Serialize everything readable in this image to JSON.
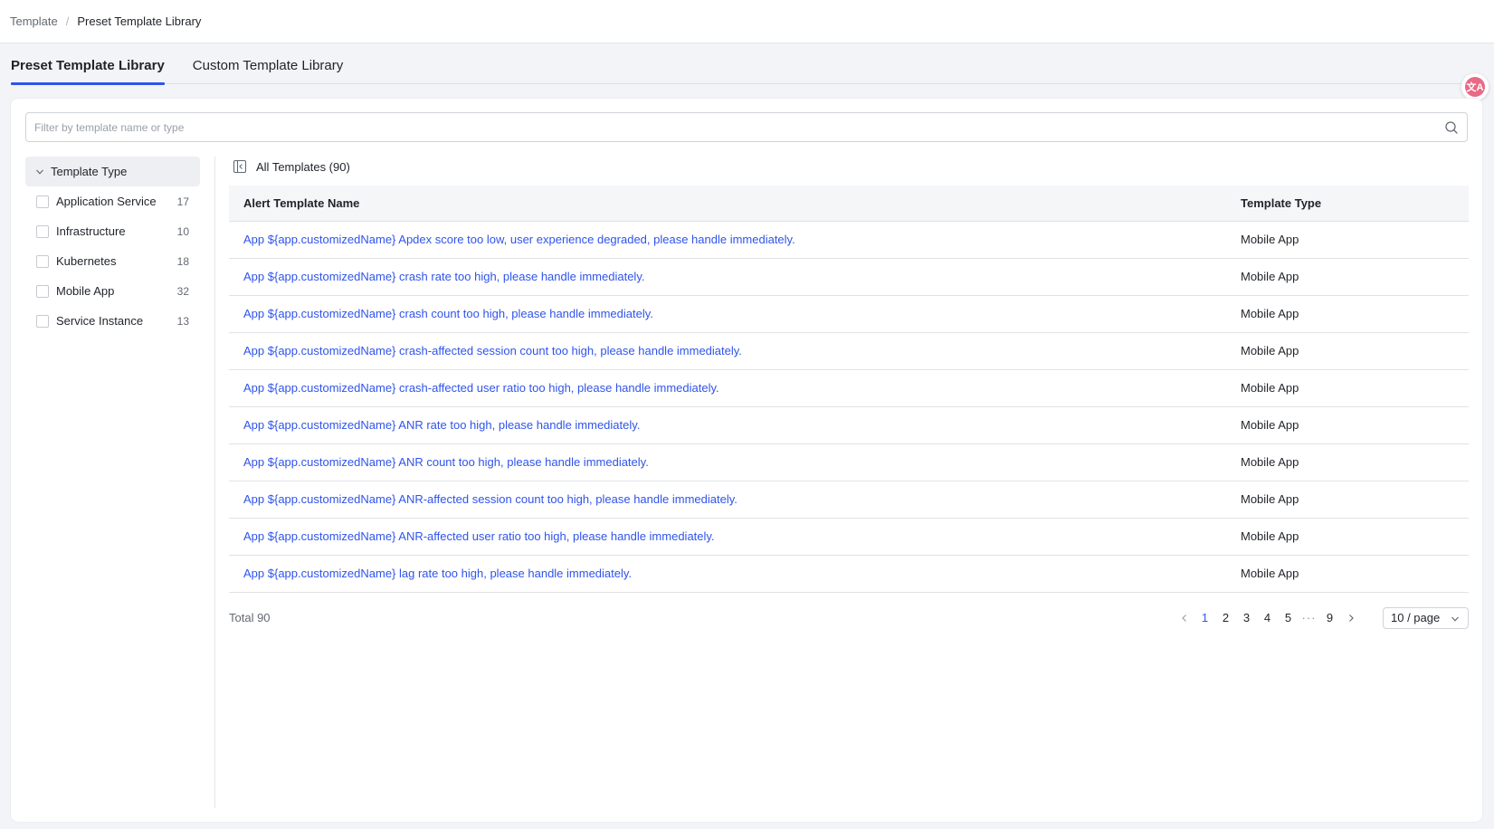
{
  "breadcrumb": {
    "root": "Template",
    "separator": "/",
    "current": "Preset Template Library"
  },
  "tabs": [
    {
      "label": "Preset Template Library",
      "active": true
    },
    {
      "label": "Custom Template Library",
      "active": false
    }
  ],
  "search": {
    "placeholder": "Filter by template name or type",
    "value": ""
  },
  "sidebar": {
    "header": "Template Type",
    "items": [
      {
        "label": "Application Service",
        "count": "17"
      },
      {
        "label": "Infrastructure",
        "count": "10"
      },
      {
        "label": "Kubernetes",
        "count": "18"
      },
      {
        "label": "Mobile App",
        "count": "32"
      },
      {
        "label": "Service Instance",
        "count": "13"
      }
    ]
  },
  "main": {
    "title": "All Templates (90)",
    "columns": {
      "name": "Alert Template Name",
      "type": "Template Type"
    },
    "rows": [
      {
        "name": "App ${app.customizedName} Apdex score too low, user experience degraded, please handle immediately.",
        "type": "Mobile App"
      },
      {
        "name": "App ${app.customizedName} crash rate too high, please handle immediately.",
        "type": "Mobile App"
      },
      {
        "name": "App ${app.customizedName} crash count too high, please handle immediately.",
        "type": "Mobile App"
      },
      {
        "name": "App ${app.customizedName} crash-affected session count too high, please handle immediately.",
        "type": "Mobile App"
      },
      {
        "name": "App ${app.customizedName} crash-affected user ratio too high, please handle immediately.",
        "type": "Mobile App"
      },
      {
        "name": "App ${app.customizedName} ANR rate too high, please handle immediately.",
        "type": "Mobile App"
      },
      {
        "name": "App ${app.customizedName} ANR count too high, please handle immediately.",
        "type": "Mobile App"
      },
      {
        "name": "App ${app.customizedName} ANR-affected session count too high, please handle immediately.",
        "type": "Mobile App"
      },
      {
        "name": "App ${app.customizedName} ANR-affected user ratio too high, please handle immediately.",
        "type": "Mobile App"
      },
      {
        "name": "App ${app.customizedName} lag rate too high, please handle immediately.",
        "type": "Mobile App"
      }
    ]
  },
  "pagination": {
    "total": "Total 90",
    "pages": [
      "1",
      "2",
      "3",
      "4",
      "5"
    ],
    "ellipsis": "···",
    "last": "9",
    "current": "1",
    "page_size": "10 / page"
  },
  "translate_button": {
    "label": "文A"
  },
  "colors": {
    "accent": "#2f54eb",
    "link": "#2f54eb",
    "translate": "#e86a86"
  },
  "icons": [
    "search-icon",
    "chevron-down-icon",
    "sidebar-collapse-icon",
    "chevron-left-icon",
    "chevron-right-icon",
    "translate-icon"
  ]
}
